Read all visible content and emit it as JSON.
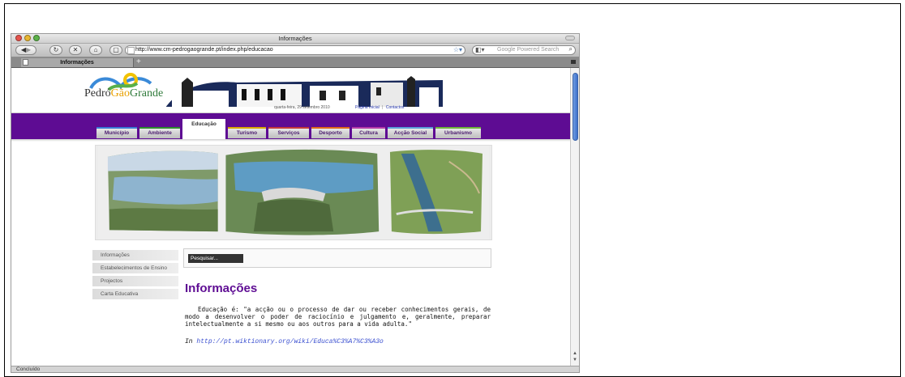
{
  "window": {
    "title": "Informações"
  },
  "toolbar": {
    "back_icon": "back-arrow-icon",
    "forward_icon": "forward-arrow-icon",
    "url": "http://www.cm-pedrogaogrande.pt/index.php/educacao",
    "search_placeholder": "Google Powered Search"
  },
  "tabs": [
    {
      "label": "Informações"
    }
  ],
  "header": {
    "logo_text_a": "Pedró",
    "logo_text_b": "Gão",
    "logo_text_c": "Grande",
    "date": "quarta-feira, 29 setembro 2010",
    "link_home": "Página Inicial",
    "link_sep": "|",
    "link_contacts": "Contactos"
  },
  "nav": [
    {
      "label": "Município",
      "color": "#3a7bd5"
    },
    {
      "label": "Ambiente",
      "color": "#2e8b2e"
    },
    {
      "label": "Educação",
      "color": "#ffffff"
    },
    {
      "label": "Turismo",
      "color": "#d9a800"
    },
    {
      "label": "Serviços",
      "color": "#c43b3b"
    },
    {
      "label": "Desporto",
      "color": "#e06a1a"
    },
    {
      "label": "Cultura",
      "color": "#b43ba8"
    },
    {
      "label": "Acção Social",
      "color": "#5a9fd8"
    },
    {
      "label": "Urbanismo",
      "color": "#6fb43a"
    }
  ],
  "sidebar": {
    "items": [
      {
        "label": "Informações"
      },
      {
        "label": "Estabelecimentos de Ensino"
      },
      {
        "label": "Projectos"
      },
      {
        "label": "Carta Educativa"
      }
    ]
  },
  "search": {
    "placeholder": "Pesquisar..."
  },
  "content": {
    "heading": "Informações",
    "paragraph": "Educação é: \"a acção ou o processo de dar ou receber conhecimentos gerais, de modo a desenvolver o poder de raciocínio e julgamento e, geralmente, preparar intelectualmente a si mesmo ou aos outros para a vida adulta.\"",
    "cite_prefix": "In",
    "cite_link": "http://pt.wiktionary.org/wiki/Educa%C3%A7%C3%A3o"
  },
  "status": {
    "text": "Concluído"
  },
  "colors": {
    "brand_purple": "#5e0c93",
    "link_blue": "#3a4fd0"
  }
}
